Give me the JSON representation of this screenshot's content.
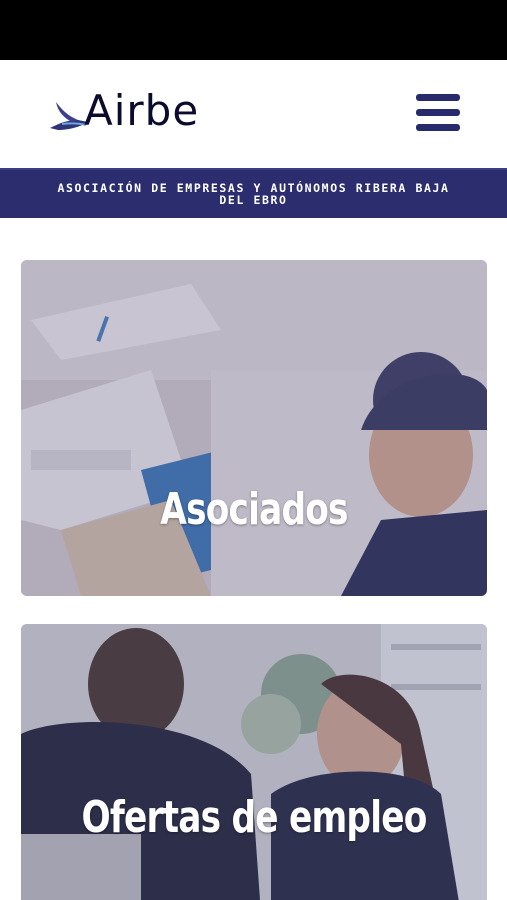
{
  "header": {
    "logo_text": "Airbe",
    "menu_icon": "hamburger-menu-icon"
  },
  "banner": {
    "text": "ASOCIACIÓN DE EMPRESAS Y AUTÓNOMOS RIBERA BAJA DEL EBRO"
  },
  "cards": [
    {
      "title": "Asociados"
    },
    {
      "title": "Ofertas de empleo"
    }
  ],
  "colors": {
    "brand_navy": "#2b2d6e",
    "menu_icon": "#272a6b",
    "logo_text": "#0b0b2e",
    "status_bar": "#000000"
  }
}
